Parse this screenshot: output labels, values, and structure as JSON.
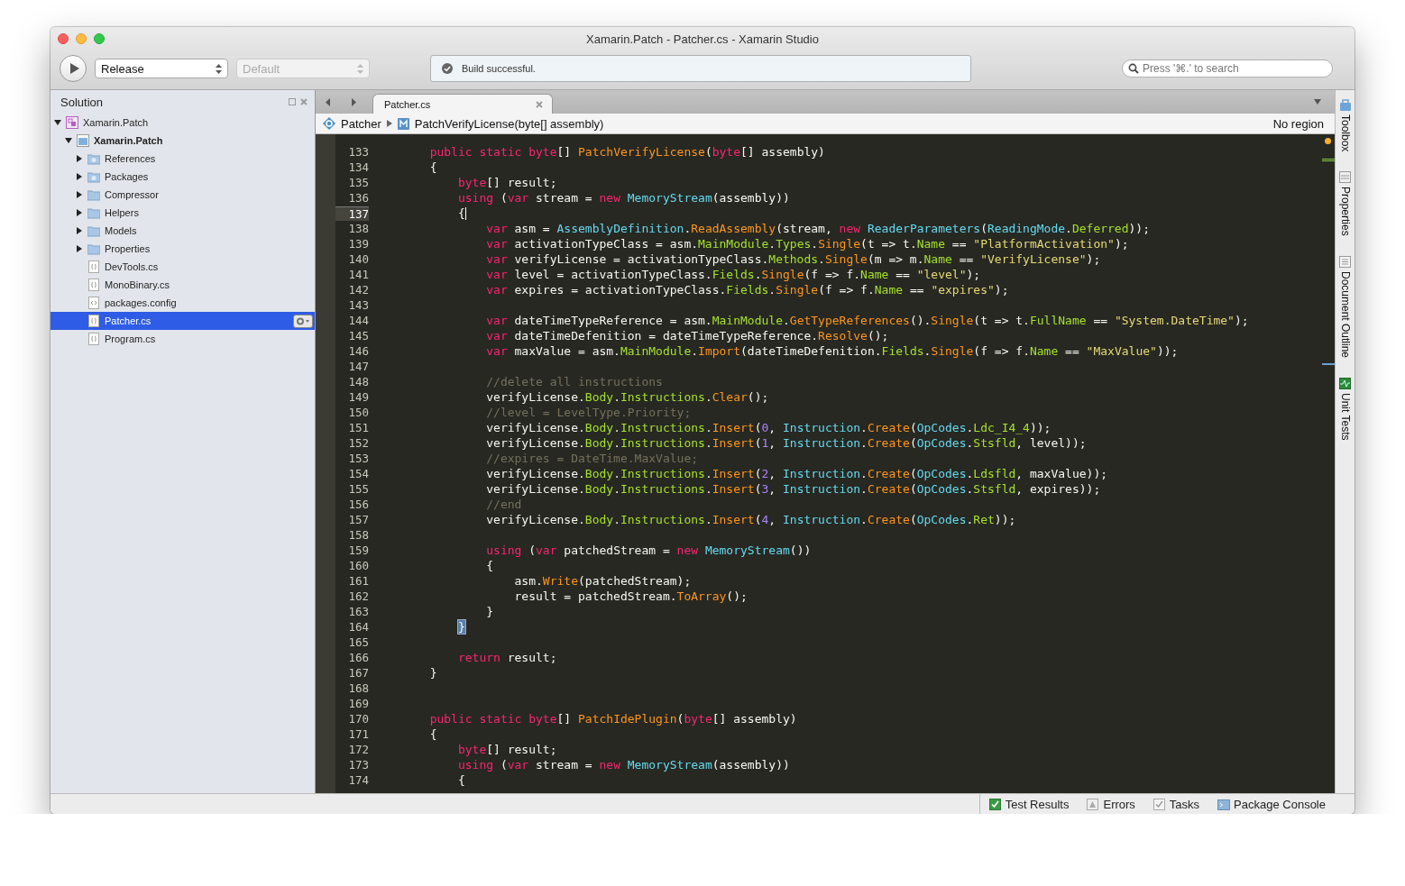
{
  "window": {
    "title": "Xamarin.Patch - Patcher.cs - Xamarin Studio"
  },
  "toolbar": {
    "configuration": {
      "value": "Release",
      "disabled": false
    },
    "target": {
      "value": "Default",
      "disabled": true
    },
    "status": "Build successful.",
    "search": {
      "placeholder": "Press '⌘.' to search"
    }
  },
  "sidebar": {
    "title": "Solution",
    "items": [
      {
        "label": "Xamarin.Patch",
        "kind": "solution",
        "expanded": true,
        "selected": false,
        "children": [
          {
            "label": "Xamarin.Patch",
            "kind": "project",
            "expanded": true,
            "selected": false,
            "children": [
              {
                "label": "References",
                "kind": "special-folder",
                "expanded": false,
                "selected": false
              },
              {
                "label": "Packages",
                "kind": "special-folder",
                "expanded": false,
                "selected": false
              },
              {
                "label": "Compressor",
                "kind": "folder",
                "expanded": false,
                "selected": false
              },
              {
                "label": "Helpers",
                "kind": "folder",
                "expanded": false,
                "selected": false
              },
              {
                "label": "Models",
                "kind": "folder",
                "expanded": false,
                "selected": false
              },
              {
                "label": "Properties",
                "kind": "folder",
                "expanded": false,
                "selected": false
              },
              {
                "label": "DevTools.cs",
                "kind": "code",
                "selected": false
              },
              {
                "label": "MonoBinary.cs",
                "kind": "code",
                "selected": false
              },
              {
                "label": "packages.config",
                "kind": "config",
                "selected": false
              },
              {
                "label": "Patcher.cs",
                "kind": "code",
                "selected": true
              },
              {
                "label": "Program.cs",
                "kind": "code",
                "selected": false
              }
            ]
          }
        ]
      }
    ]
  },
  "tabs": [
    {
      "label": "Patcher.cs",
      "selected": true
    }
  ],
  "breadcrumb": {
    "class": "Patcher",
    "method": "PatchVerifyLicense(byte[] assembly)",
    "region": "No region"
  },
  "editor": {
    "lines": [
      {
        "number": "133",
        "current": false,
        "tokens": [
          {
            "kind": "keyword",
            "text": "        public static byte"
          },
          {
            "kind": "plain",
            "text": "[] "
          },
          {
            "kind": "function",
            "text": "PatchVerifyLicense"
          },
          {
            "kind": "plain",
            "text": "("
          },
          {
            "kind": "keyword",
            "text": "byte"
          },
          {
            "kind": "plain",
            "text": "[] assembly)"
          }
        ]
      },
      {
        "number": "134",
        "current": false,
        "tokens": [
          {
            "kind": "plain",
            "text": "        {"
          }
        ]
      },
      {
        "number": "135",
        "current": false,
        "tokens": [
          {
            "kind": "keyword",
            "text": "            byte"
          },
          {
            "kind": "plain",
            "text": "[] result;"
          }
        ]
      },
      {
        "number": "136",
        "current": false,
        "tokens": [
          {
            "kind": "keyword",
            "text": "            using"
          },
          {
            "kind": "plain",
            "text": " ("
          },
          {
            "kind": "keyword",
            "text": "var"
          },
          {
            "kind": "plain",
            "text": " stream = "
          },
          {
            "kind": "keyword",
            "text": "new"
          },
          {
            "kind": "type",
            "text": " MemoryStream"
          },
          {
            "kind": "plain",
            "text": "(assembly))"
          }
        ]
      },
      {
        "number": "137",
        "current": true,
        "tokens": [
          {
            "kind": "plain",
            "text": "            {"
          }
        ]
      },
      {
        "number": "138",
        "current": false,
        "tokens": [
          {
            "kind": "keyword",
            "text": "                var"
          },
          {
            "kind": "plain",
            "text": " asm = "
          },
          {
            "kind": "type",
            "text": "AssemblyDefinition"
          },
          {
            "kind": "plain",
            "text": "."
          },
          {
            "kind": "function",
            "text": "ReadAssembly"
          },
          {
            "kind": "plain",
            "text": "(stream, "
          },
          {
            "kind": "keyword",
            "text": "new"
          },
          {
            "kind": "type",
            "text": " ReaderParameters"
          },
          {
            "kind": "plain",
            "text": "("
          },
          {
            "kind": "type",
            "text": "ReadingMode"
          },
          {
            "kind": "plain",
            "text": "."
          },
          {
            "kind": "member",
            "text": "Deferred"
          },
          {
            "kind": "plain",
            "text": "));"
          }
        ]
      },
      {
        "number": "139",
        "current": false,
        "tokens": [
          {
            "kind": "keyword",
            "text": "                var"
          },
          {
            "kind": "plain",
            "text": " activationTypeClass = asm."
          },
          {
            "kind": "member",
            "text": "MainModule"
          },
          {
            "kind": "plain",
            "text": "."
          },
          {
            "kind": "member",
            "text": "Types"
          },
          {
            "kind": "plain",
            "text": "."
          },
          {
            "kind": "function",
            "text": "Single"
          },
          {
            "kind": "plain",
            "text": "(t => t."
          },
          {
            "kind": "member",
            "text": "Name"
          },
          {
            "kind": "plain",
            "text": " == "
          },
          {
            "kind": "string",
            "text": "\"PlatformActivation\""
          },
          {
            "kind": "plain",
            "text": ");"
          }
        ]
      },
      {
        "number": "140",
        "current": false,
        "tokens": [
          {
            "kind": "keyword",
            "text": "                var"
          },
          {
            "kind": "plain",
            "text": " verifyLicense = activationTypeClass."
          },
          {
            "kind": "member",
            "text": "Methods"
          },
          {
            "kind": "plain",
            "text": "."
          },
          {
            "kind": "function",
            "text": "Single"
          },
          {
            "kind": "plain",
            "text": "(m => m."
          },
          {
            "kind": "member",
            "text": "Name"
          },
          {
            "kind": "plain",
            "text": " == "
          },
          {
            "kind": "string",
            "text": "\"VerifyLicense\""
          },
          {
            "kind": "plain",
            "text": ");"
          }
        ]
      },
      {
        "number": "141",
        "current": false,
        "tokens": [
          {
            "kind": "keyword",
            "text": "                var"
          },
          {
            "kind": "plain",
            "text": " level = activationTypeClass."
          },
          {
            "kind": "member",
            "text": "Fields"
          },
          {
            "kind": "plain",
            "text": "."
          },
          {
            "kind": "function",
            "text": "Single"
          },
          {
            "kind": "plain",
            "text": "(f => f."
          },
          {
            "kind": "member",
            "text": "Name"
          },
          {
            "kind": "plain",
            "text": " == "
          },
          {
            "kind": "string",
            "text": "\"level\""
          },
          {
            "kind": "plain",
            "text": ");"
          }
        ]
      },
      {
        "number": "142",
        "current": false,
        "tokens": [
          {
            "kind": "keyword",
            "text": "                var"
          },
          {
            "kind": "plain",
            "text": " expires = activationTypeClass."
          },
          {
            "kind": "member",
            "text": "Fields"
          },
          {
            "kind": "plain",
            "text": "."
          },
          {
            "kind": "function",
            "text": "Single"
          },
          {
            "kind": "plain",
            "text": "(f => f."
          },
          {
            "kind": "member",
            "text": "Name"
          },
          {
            "kind": "plain",
            "text": " == "
          },
          {
            "kind": "string",
            "text": "\"expires\""
          },
          {
            "kind": "plain",
            "text": ");"
          }
        ]
      },
      {
        "number": "143",
        "current": false
      },
      {
        "number": "144",
        "current": false,
        "tokens": [
          {
            "kind": "keyword",
            "text": "                var"
          },
          {
            "kind": "plain",
            "text": " dateTimeTypeReference = asm."
          },
          {
            "kind": "member",
            "text": "MainModule"
          },
          {
            "kind": "plain",
            "text": "."
          },
          {
            "kind": "function",
            "text": "GetTypeReferences"
          },
          {
            "kind": "plain",
            "text": "()."
          },
          {
            "kind": "function",
            "text": "Single"
          },
          {
            "kind": "plain",
            "text": "(t => t."
          },
          {
            "kind": "member",
            "text": "FullName"
          },
          {
            "kind": "plain",
            "text": " == "
          },
          {
            "kind": "string",
            "text": "\"System.DateTime\""
          },
          {
            "kind": "plain",
            "text": ");"
          }
        ]
      },
      {
        "number": "145",
        "current": false,
        "tokens": [
          {
            "kind": "keyword",
            "text": "                var"
          },
          {
            "kind": "plain",
            "text": " dateTimeDefenition = dateTimeTypeReference."
          },
          {
            "kind": "function",
            "text": "Resolve"
          },
          {
            "kind": "plain",
            "text": "();"
          }
        ]
      },
      {
        "number": "146",
        "current": false,
        "tokens": [
          {
            "kind": "keyword",
            "text": "                var"
          },
          {
            "kind": "plain",
            "text": " maxValue = asm."
          },
          {
            "kind": "member",
            "text": "MainModule"
          },
          {
            "kind": "plain",
            "text": "."
          },
          {
            "kind": "function",
            "text": "Import"
          },
          {
            "kind": "plain",
            "text": "(dateTimeDefenition."
          },
          {
            "kind": "member",
            "text": "Fields"
          },
          {
            "kind": "plain",
            "text": "."
          },
          {
            "kind": "function",
            "text": "Single"
          },
          {
            "kind": "plain",
            "text": "(f => f."
          },
          {
            "kind": "member",
            "text": "Name"
          },
          {
            "kind": "plain",
            "text": " == "
          },
          {
            "kind": "string",
            "text": "\"MaxValue\""
          },
          {
            "kind": "plain",
            "text": "));"
          }
        ]
      },
      {
        "number": "147",
        "current": false
      },
      {
        "number": "148",
        "current": false,
        "tokens": [
          {
            "kind": "comment",
            "text": "                //delete all instructions"
          }
        ]
      },
      {
        "number": "149",
        "current": false,
        "tokens": [
          {
            "kind": "plain",
            "text": "                verifyLicense."
          },
          {
            "kind": "member",
            "text": "Body"
          },
          {
            "kind": "plain",
            "text": "."
          },
          {
            "kind": "member",
            "text": "Instructions"
          },
          {
            "kind": "plain",
            "text": "."
          },
          {
            "kind": "function",
            "text": "Clear"
          },
          {
            "kind": "plain",
            "text": "();"
          }
        ]
      },
      {
        "number": "150",
        "current": false,
        "tokens": [
          {
            "kind": "comment",
            "text": "                //level = LevelType.Priority;"
          }
        ]
      },
      {
        "number": "151",
        "current": false,
        "tokens": [
          {
            "kind": "plain",
            "text": "                verifyLicense."
          },
          {
            "kind": "member",
            "text": "Body"
          },
          {
            "kind": "plain",
            "text": "."
          },
          {
            "kind": "member",
            "text": "Instructions"
          },
          {
            "kind": "plain",
            "text": "."
          },
          {
            "kind": "function",
            "text": "Insert"
          },
          {
            "kind": "plain",
            "text": "("
          },
          {
            "kind": "number",
            "text": "0"
          },
          {
            "kind": "plain",
            "text": ", "
          },
          {
            "kind": "type",
            "text": "Instruction"
          },
          {
            "kind": "plain",
            "text": "."
          },
          {
            "kind": "function",
            "text": "Create"
          },
          {
            "kind": "plain",
            "text": "("
          },
          {
            "kind": "type",
            "text": "OpCodes"
          },
          {
            "kind": "plain",
            "text": "."
          },
          {
            "kind": "member",
            "text": "Ldc_I4_4"
          },
          {
            "kind": "plain",
            "text": "));"
          }
        ]
      },
      {
        "number": "152",
        "current": false,
        "tokens": [
          {
            "kind": "plain",
            "text": "                verifyLicense."
          },
          {
            "kind": "member",
            "text": "Body"
          },
          {
            "kind": "plain",
            "text": "."
          },
          {
            "kind": "member",
            "text": "Instructions"
          },
          {
            "kind": "plain",
            "text": "."
          },
          {
            "kind": "function",
            "text": "Insert"
          },
          {
            "kind": "plain",
            "text": "("
          },
          {
            "kind": "number",
            "text": "1"
          },
          {
            "kind": "plain",
            "text": ", "
          },
          {
            "kind": "type",
            "text": "Instruction"
          },
          {
            "kind": "plain",
            "text": "."
          },
          {
            "kind": "function",
            "text": "Create"
          },
          {
            "kind": "plain",
            "text": "("
          },
          {
            "kind": "type",
            "text": "OpCodes"
          },
          {
            "kind": "plain",
            "text": "."
          },
          {
            "kind": "member",
            "text": "Stsfld"
          },
          {
            "kind": "plain",
            "text": ", level));"
          }
        ]
      },
      {
        "number": "153",
        "current": false,
        "tokens": [
          {
            "kind": "comment",
            "text": "                //expires = DateTime.MaxValue;"
          }
        ]
      },
      {
        "number": "154",
        "current": false,
        "tokens": [
          {
            "kind": "plain",
            "text": "                verifyLicense."
          },
          {
            "kind": "member",
            "text": "Body"
          },
          {
            "kind": "plain",
            "text": "."
          },
          {
            "kind": "member",
            "text": "Instructions"
          },
          {
            "kind": "plain",
            "text": "."
          },
          {
            "kind": "function",
            "text": "Insert"
          },
          {
            "kind": "plain",
            "text": "("
          },
          {
            "kind": "number",
            "text": "2"
          },
          {
            "kind": "plain",
            "text": ", "
          },
          {
            "kind": "type",
            "text": "Instruction"
          },
          {
            "kind": "plain",
            "text": "."
          },
          {
            "kind": "function",
            "text": "Create"
          },
          {
            "kind": "plain",
            "text": "("
          },
          {
            "kind": "type",
            "text": "OpCodes"
          },
          {
            "kind": "plain",
            "text": "."
          },
          {
            "kind": "member",
            "text": "Ldsfld"
          },
          {
            "kind": "plain",
            "text": ", maxValue));"
          }
        ]
      },
      {
        "number": "155",
        "current": false,
        "tokens": [
          {
            "kind": "plain",
            "text": "                verifyLicense."
          },
          {
            "kind": "member",
            "text": "Body"
          },
          {
            "kind": "plain",
            "text": "."
          },
          {
            "kind": "member",
            "text": "Instructions"
          },
          {
            "kind": "plain",
            "text": "."
          },
          {
            "kind": "function",
            "text": "Insert"
          },
          {
            "kind": "plain",
            "text": "("
          },
          {
            "kind": "number",
            "text": "3"
          },
          {
            "kind": "plain",
            "text": ", "
          },
          {
            "kind": "type",
            "text": "Instruction"
          },
          {
            "kind": "plain",
            "text": "."
          },
          {
            "kind": "function",
            "text": "Create"
          },
          {
            "kind": "plain",
            "text": "("
          },
          {
            "kind": "type",
            "text": "OpCodes"
          },
          {
            "kind": "plain",
            "text": "."
          },
          {
            "kind": "member",
            "text": "Stsfld"
          },
          {
            "kind": "plain",
            "text": ", expires));"
          }
        ]
      },
      {
        "number": "156",
        "current": false,
        "tokens": [
          {
            "kind": "comment",
            "text": "                //end"
          }
        ]
      },
      {
        "number": "157",
        "current": false,
        "tokens": [
          {
            "kind": "plain",
            "text": "                verifyLicense."
          },
          {
            "kind": "member",
            "text": "Body"
          },
          {
            "kind": "plain",
            "text": "."
          },
          {
            "kind": "member",
            "text": "Instructions"
          },
          {
            "kind": "plain",
            "text": "."
          },
          {
            "kind": "function",
            "text": "Insert"
          },
          {
            "kind": "plain",
            "text": "("
          },
          {
            "kind": "number",
            "text": "4"
          },
          {
            "kind": "plain",
            "text": ", "
          },
          {
            "kind": "type",
            "text": "Instruction"
          },
          {
            "kind": "plain",
            "text": "."
          },
          {
            "kind": "function",
            "text": "Create"
          },
          {
            "kind": "plain",
            "text": "("
          },
          {
            "kind": "type",
            "text": "OpCodes"
          },
          {
            "kind": "plain",
            "text": "."
          },
          {
            "kind": "member",
            "text": "Ret"
          },
          {
            "kind": "plain",
            "text": "));"
          }
        ]
      },
      {
        "number": "158",
        "current": false
      },
      {
        "number": "159",
        "current": false,
        "tokens": [
          {
            "kind": "keyword",
            "text": "                using"
          },
          {
            "kind": "plain",
            "text": " ("
          },
          {
            "kind": "keyword",
            "text": "var"
          },
          {
            "kind": "plain",
            "text": " patchedStream = "
          },
          {
            "kind": "keyword",
            "text": "new"
          },
          {
            "kind": "type",
            "text": " MemoryStream"
          },
          {
            "kind": "plain",
            "text": "())"
          }
        ]
      },
      {
        "number": "160",
        "current": false,
        "tokens": [
          {
            "kind": "plain",
            "text": "                {"
          }
        ]
      },
      {
        "number": "161",
        "current": false,
        "tokens": [
          {
            "kind": "plain",
            "text": "                    asm."
          },
          {
            "kind": "function",
            "text": "Write"
          },
          {
            "kind": "plain",
            "text": "(patchedStream);"
          }
        ]
      },
      {
        "number": "162",
        "current": false,
        "tokens": [
          {
            "kind": "plain",
            "text": "                    result = patchedStream."
          },
          {
            "kind": "function",
            "text": "ToArray"
          },
          {
            "kind": "plain",
            "text": "();"
          }
        ]
      },
      {
        "number": "163",
        "current": false,
        "tokens": [
          {
            "kind": "plain",
            "text": "                }"
          }
        ]
      },
      {
        "number": "164",
        "current": false,
        "tokens": [
          {
            "kind": "brace",
            "text": "            }"
          }
        ]
      },
      {
        "number": "165",
        "current": false
      },
      {
        "number": "166",
        "current": false,
        "tokens": [
          {
            "kind": "keyword",
            "text": "            return"
          },
          {
            "kind": "plain",
            "text": " result;"
          }
        ]
      },
      {
        "number": "167",
        "current": false,
        "tokens": [
          {
            "kind": "plain",
            "text": "        }"
          }
        ]
      },
      {
        "number": "168",
        "current": false
      },
      {
        "number": "169",
        "current": false
      },
      {
        "number": "170",
        "current": false,
        "tokens": [
          {
            "kind": "keyword",
            "text": "        public static byte"
          },
          {
            "kind": "plain",
            "text": "[] "
          },
          {
            "kind": "function",
            "text": "PatchIdePlugin"
          },
          {
            "kind": "plain",
            "text": "("
          },
          {
            "kind": "keyword",
            "text": "byte"
          },
          {
            "kind": "plain",
            "text": "[] assembly)"
          }
        ]
      },
      {
        "number": "171",
        "current": false,
        "tokens": [
          {
            "kind": "plain",
            "text": "        {"
          }
        ]
      },
      {
        "number": "172",
        "current": false,
        "tokens": [
          {
            "kind": "keyword",
            "text": "            byte"
          },
          {
            "kind": "plain",
            "text": "[] result;"
          }
        ]
      },
      {
        "number": "173",
        "current": false,
        "tokens": [
          {
            "kind": "keyword",
            "text": "            using"
          },
          {
            "kind": "plain",
            "text": " ("
          },
          {
            "kind": "keyword",
            "text": "var"
          },
          {
            "kind": "plain",
            "text": " stream = "
          },
          {
            "kind": "keyword",
            "text": "new"
          },
          {
            "kind": "type",
            "text": " MemoryStream"
          },
          {
            "kind": "plain",
            "text": "(assembly))"
          }
        ]
      },
      {
        "number": "174",
        "current": false,
        "tokens": [
          {
            "kind": "plain",
            "text": "            {"
          }
        ]
      }
    ]
  },
  "dock": [
    {
      "label": "Toolbox",
      "kind": "toolbox"
    },
    {
      "label": "Properties",
      "kind": "properties"
    },
    {
      "label": "Document Outline",
      "kind": "outline"
    },
    {
      "label": "Unit Tests",
      "kind": "tests"
    }
  ],
  "pads": [
    {
      "label": "Test Results",
      "kind": "tests"
    },
    {
      "label": "Errors",
      "kind": "errors"
    },
    {
      "label": "Tasks",
      "kind": "tasks"
    },
    {
      "label": "Package Console",
      "kind": "console"
    }
  ]
}
